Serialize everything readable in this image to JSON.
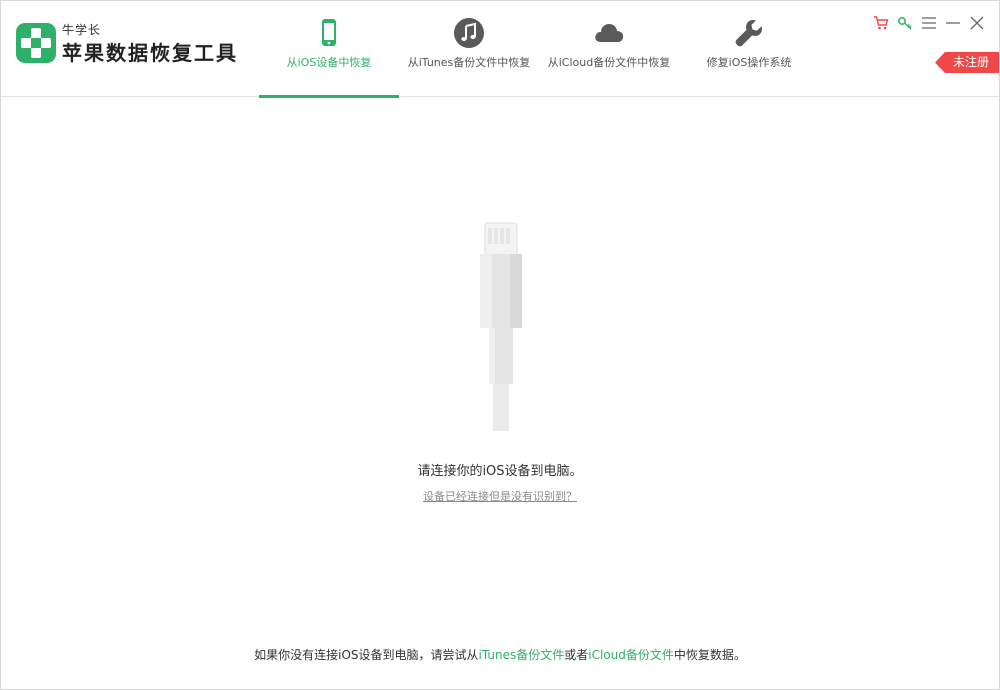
{
  "brand": {
    "small": "牛学长",
    "title": "苹果数据恢复工具"
  },
  "tabs": [
    {
      "label": "从iOS设备中恢复",
      "icon": "phone-icon",
      "active": true
    },
    {
      "label": "从iTunes备份文件中恢复",
      "icon": "music-note-icon",
      "active": false
    },
    {
      "label": "从iCloud备份文件中恢复",
      "icon": "cloud-icon",
      "active": false
    },
    {
      "label": "修复iOS操作系统",
      "icon": "wrench-icon",
      "active": false
    }
  ],
  "window_controls": [
    "cart-icon",
    "key-icon",
    "menu-icon",
    "minimize-icon",
    "close-icon"
  ],
  "badge": "未注册",
  "main": {
    "prompt": "请连接你的iOS设备到电脑。",
    "help_link": "设备已经连接但是没有识别到？"
  },
  "footer": {
    "part1": "如果你没有连接iOS设备到电脑，请尝试从",
    "link1": "iTunes备份文件",
    "part2": "或者",
    "link2": "iCloud备份文件",
    "part3": "中恢复数据。"
  },
  "colors": {
    "accent": "#2fb068",
    "badge": "#f04848",
    "icon_gray": "#5a5a5a"
  }
}
